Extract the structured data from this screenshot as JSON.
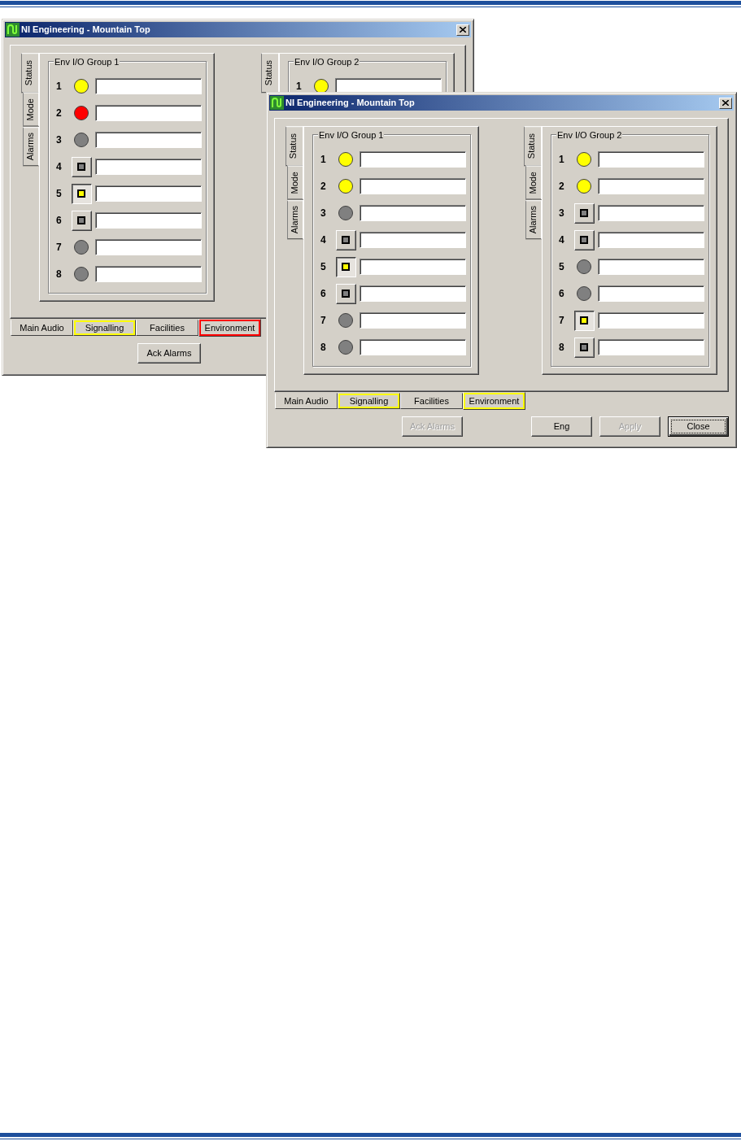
{
  "windows": [
    {
      "title": "NI Engineering - Mountain Top",
      "groups": [
        {
          "title": "Env I/O Group 1",
          "side_tabs": [
            {
              "label": "Status",
              "selected": true
            },
            {
              "label": "Mode",
              "selected": false
            },
            {
              "label": "Alarms",
              "selected": false
            }
          ],
          "rows": [
            {
              "number": "1",
              "kind": "led",
              "color": "#ffff00"
            },
            {
              "number": "2",
              "kind": "led",
              "color": "#ff0000"
            },
            {
              "number": "3",
              "kind": "led",
              "color": "#808080"
            },
            {
              "number": "4",
              "kind": "button",
              "color": "#808080",
              "pressed": false
            },
            {
              "number": "5",
              "kind": "button",
              "color": "#ffff00",
              "pressed": true
            },
            {
              "number": "6",
              "kind": "button",
              "color": "#808080",
              "pressed": false
            },
            {
              "number": "7",
              "kind": "led",
              "color": "#808080"
            },
            {
              "number": "8",
              "kind": "led",
              "color": "#808080"
            }
          ]
        },
        {
          "title": "Env I/O Group 2",
          "side_tabs": [
            {
              "label": "Status",
              "selected": true
            }
          ],
          "rows": [
            {
              "number": "1",
              "kind": "led",
              "color": "#ffff00"
            }
          ]
        }
      ],
      "tabs": [
        {
          "label": "Main Audio",
          "selected": false
        },
        {
          "label": "Signalling",
          "selected": false,
          "color": "#ffff00"
        },
        {
          "label": "Facilities",
          "selected": false
        },
        {
          "label": "Environment",
          "selected": true,
          "color": "#ff0000"
        }
      ],
      "buttons": [
        {
          "label": "Ack Alarms",
          "disabled": false,
          "default": false
        }
      ]
    },
    {
      "title": "NI Engineering - Mountain Top",
      "groups": [
        {
          "title": "Env I/O Group 1",
          "side_tabs": [
            {
              "label": "Status",
              "selected": true
            },
            {
              "label": "Mode",
              "selected": false
            },
            {
              "label": "Alarms",
              "selected": false
            }
          ],
          "rows": [
            {
              "number": "1",
              "kind": "led",
              "color": "#ffff00"
            },
            {
              "number": "2",
              "kind": "led",
              "color": "#ffff00"
            },
            {
              "number": "3",
              "kind": "led",
              "color": "#808080"
            },
            {
              "number": "4",
              "kind": "button",
              "color": "#808080",
              "pressed": false
            },
            {
              "number": "5",
              "kind": "button",
              "color": "#ffff00",
              "pressed": true
            },
            {
              "number": "6",
              "kind": "button",
              "color": "#808080",
              "pressed": false
            },
            {
              "number": "7",
              "kind": "led",
              "color": "#808080"
            },
            {
              "number": "8",
              "kind": "led",
              "color": "#808080"
            }
          ]
        },
        {
          "title": "Env I/O Group 2",
          "side_tabs": [
            {
              "label": "Status",
              "selected": true
            },
            {
              "label": "Mode",
              "selected": false
            },
            {
              "label": "Alarms",
              "selected": false
            }
          ],
          "rows": [
            {
              "number": "1",
              "kind": "led",
              "color": "#ffff00"
            },
            {
              "number": "2",
              "kind": "led",
              "color": "#ffff00"
            },
            {
              "number": "3",
              "kind": "button",
              "color": "#808080",
              "pressed": false
            },
            {
              "number": "4",
              "kind": "button",
              "color": "#808080",
              "pressed": false
            },
            {
              "number": "5",
              "kind": "led",
              "color": "#808080"
            },
            {
              "number": "6",
              "kind": "led",
              "color": "#808080"
            },
            {
              "number": "7",
              "kind": "button",
              "color": "#ffff00",
              "pressed": true
            },
            {
              "number": "8",
              "kind": "button",
              "color": "#808080",
              "pressed": false
            }
          ]
        }
      ],
      "tabs": [
        {
          "label": "Main Audio",
          "selected": false
        },
        {
          "label": "Signalling",
          "selected": false,
          "color": "#ffff00"
        },
        {
          "label": "Facilities",
          "selected": false
        },
        {
          "label": "Environment",
          "selected": true,
          "color": "#ffff00"
        }
      ],
      "buttons": [
        {
          "label": "Ack Alarms",
          "disabled": true,
          "default": false
        },
        {
          "label": "Eng",
          "disabled": false,
          "default": false
        },
        {
          "label": "Apply",
          "disabled": true,
          "default": false
        },
        {
          "label": "Close",
          "disabled": false,
          "default": true
        }
      ]
    }
  ]
}
